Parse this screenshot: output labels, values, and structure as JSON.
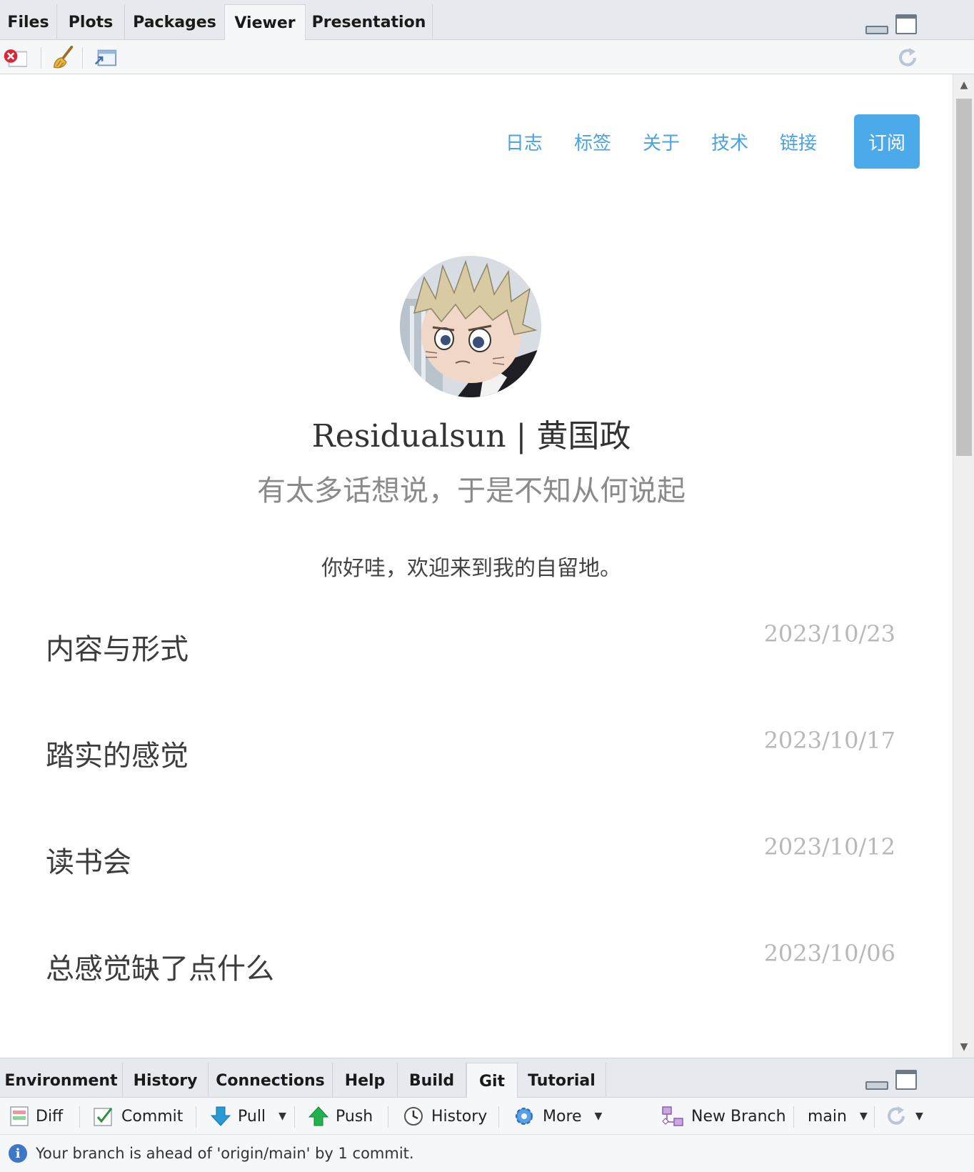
{
  "top_pane": {
    "tabs": [
      "Files",
      "Plots",
      "Packages",
      "Viewer",
      "Presentation"
    ],
    "active_tab": "Viewer"
  },
  "viewer_toolbar": {
    "icons": [
      "remove-viewer-icon",
      "clear-all-icon",
      "show-in-window-icon",
      "refresh-icon"
    ]
  },
  "site": {
    "nav": [
      "日志",
      "标签",
      "关于",
      "技术",
      "链接"
    ],
    "subscribe": "订阅",
    "title": "Residualsun | 黄国政",
    "subtitle": "有太多话想说，于是不知从何说起",
    "welcome": "你好哇，欢迎来到我的自留地。",
    "posts": [
      {
        "title": "内容与形式",
        "date": "2023/10/23"
      },
      {
        "title": "踏实的感觉",
        "date": "2023/10/17"
      },
      {
        "title": "读书会",
        "date": "2023/10/12"
      },
      {
        "title": "总感觉缺了点什么",
        "date": "2023/10/06"
      }
    ]
  },
  "bottom_pane": {
    "tabs": [
      "Environment",
      "History",
      "Connections",
      "Help",
      "Build",
      "Git",
      "Tutorial"
    ],
    "active_tab": "Git"
  },
  "git_toolbar": {
    "diff": "Diff",
    "commit": "Commit",
    "pull": "Pull",
    "push": "Push",
    "history": "History",
    "more": "More",
    "new_branch": "New Branch",
    "branch": "main"
  },
  "status_message": "Your branch is ahead of 'origin/main' by 1 commit."
}
